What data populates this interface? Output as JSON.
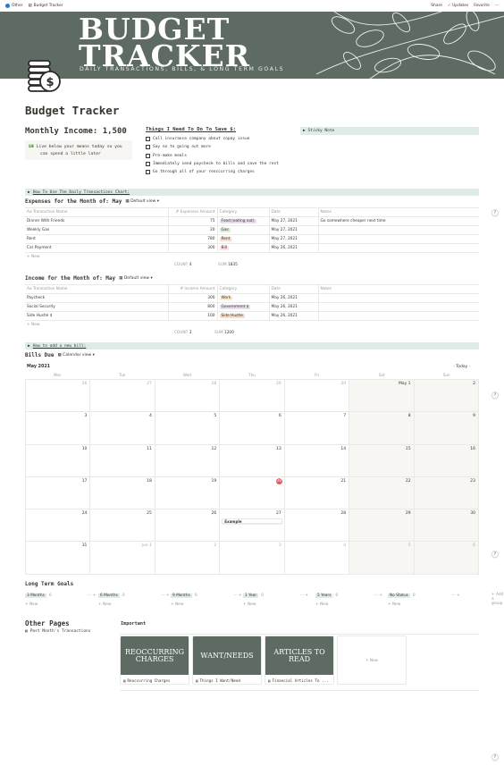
{
  "topbar": {
    "workspace": "Other",
    "page": "Budget Tracker",
    "share": "Share",
    "updates": "Updates",
    "favorite": "Favorite",
    "more": "···"
  },
  "banner": {
    "title_line1": "BUDGET",
    "title_line2": "TRACKER",
    "subtitle": "DAILY TRANSACTIONS, BILLS, & LONG TERM GOALS"
  },
  "page_title": "Budget Tracker",
  "monthly_income": "Monthly Income: 1,500",
  "callout": {
    "icon": "💵",
    "line1": "Live below your means today so you",
    "line2": "can spend a little later"
  },
  "todo": {
    "title": "Things I Need To Do To Save $:",
    "items": [
      "Call insurance company about copay issue",
      "Say no to going out more",
      "Pre-make meals",
      "Immediately send paycheck to bills and save the rest",
      "Go through all of your reoccurring charges"
    ]
  },
  "sticky_note": "Sticky Note",
  "toggle_transactions": "How To Use The Daily Transactions Chart:",
  "expenses": {
    "title": "Expenses for the Month of: May",
    "view": "Default view",
    "columns": [
      "Aa Transaction Name",
      "# Expenses Amount",
      "Category",
      "Date",
      "Notes"
    ],
    "rows": [
      {
        "name": "Dinner With Friends",
        "amount": "75",
        "category": "Food (eating out)",
        "cat_color": "#e8deee",
        "date": "May 27, 2021",
        "note": "Go somewhere cheaper next time"
      },
      {
        "name": "Weekly Gas",
        "amount": "20",
        "category": "Gas",
        "cat_color": "#dbeddb",
        "date": "May 27, 2021",
        "note": ""
      },
      {
        "name": "Rent",
        "amount": "780",
        "category": "Rent",
        "cat_color": "#fadec9",
        "date": "May 27, 2021",
        "note": ""
      },
      {
        "name": "Car Payment",
        "amount": "300",
        "category": "Bill",
        "cat_color": "#ffe2dd",
        "date": "May 26, 2021",
        "note": ""
      }
    ],
    "new": "+ New",
    "count_label": "COUNT",
    "count": "4",
    "sum_label": "SUM",
    "sum": "1835"
  },
  "income": {
    "title": "Income for the Month of: May",
    "view": "Default view",
    "columns": [
      "Aa Transaction Name",
      "# Income Amount",
      "Category",
      "Date",
      "Notes"
    ],
    "rows": [
      {
        "name": "Paycheck",
        "amount": "300",
        "category": "Work",
        "cat_color": "#fdecc8",
        "date": "May 26, 2021"
      },
      {
        "name": "Social Security",
        "amount": "800",
        "category": "Government $",
        "cat_color": "#e8deee",
        "date": "May 26, 2021"
      },
      {
        "name": "Side Hustle $",
        "amount": "100",
        "category": "Side Hustle",
        "cat_color": "#fadec9",
        "date": "May 26, 2021"
      }
    ],
    "new": "+ New",
    "count_label": "COUNT",
    "count": "3",
    "sum_label": "SUM",
    "sum": "1200"
  },
  "toggle_bill": "How to add a new bill:",
  "bills": {
    "title": "Bills Due",
    "view": "Calendar view",
    "month": "May 2021",
    "today": "Today",
    "days": [
      "Mon",
      "Tue",
      "Wed",
      "Thu",
      "Fri",
      "Sat",
      "Sun"
    ],
    "event": "Example"
  },
  "long_term": {
    "title": "Long Term Goals",
    "groups": [
      {
        "label": "3 Months",
        "count": "0"
      },
      {
        "label": "6 Months",
        "count": "0"
      },
      {
        "label": "9 Months",
        "count": "0"
      },
      {
        "label": "1 Year",
        "count": "0"
      },
      {
        "label": "5 Years",
        "count": "0"
      },
      {
        "label": "No Status",
        "count": "0"
      }
    ],
    "new": "+ New",
    "add_group": "+ Add a group"
  },
  "other_pages": {
    "title": "Other Pages",
    "link": "Past Month's Transactions"
  },
  "important": {
    "title": "Important",
    "cards": [
      {
        "img": "REOCCURRING CHARGES",
        "caption": "Reoccurring Charges"
      },
      {
        "img": "WANT/NEEDS",
        "caption": "Things I Want/Need"
      },
      {
        "img": "ARTICLES TO READ",
        "caption": "Financial Articles To ..."
      }
    ],
    "new": "+ New"
  },
  "help": "?"
}
